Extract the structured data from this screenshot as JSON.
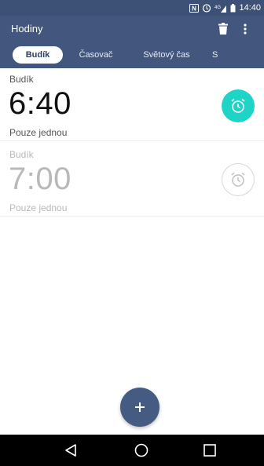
{
  "status_bar": {
    "time": "14:40"
  },
  "app_bar": {
    "title": "Hodiny"
  },
  "tabs": [
    {
      "label": "Budík"
    },
    {
      "label": "Časovač"
    },
    {
      "label": "Světový čas"
    },
    {
      "label": "S"
    }
  ],
  "alarms": [
    {
      "label": "Budík",
      "time": "6:40",
      "repeat": "Pouze jednou",
      "enabled": true
    },
    {
      "label": "Budík",
      "time": "7:00",
      "repeat": "Pouze jednou",
      "enabled": false
    }
  ],
  "fab": {
    "icon": "plus-icon",
    "symbol": "+"
  },
  "colors": {
    "app_bar": "#43577e",
    "status_bar": "#3d5177",
    "toggle_on": "#1ed4c6",
    "fab": "#465b82"
  }
}
